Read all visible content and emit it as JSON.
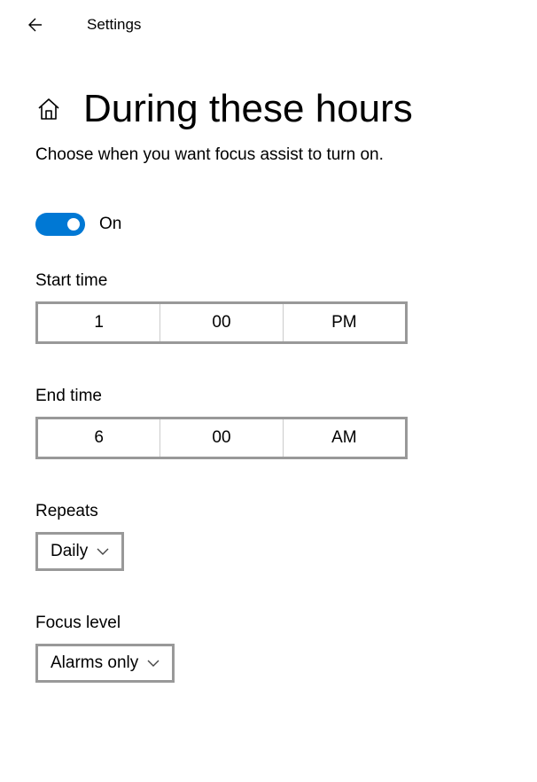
{
  "header": {
    "title": "Settings"
  },
  "page": {
    "title": "During these hours",
    "subtitle": "Choose when you want focus assist to turn on."
  },
  "toggle": {
    "label": "On",
    "state": true
  },
  "start_time": {
    "label": "Start time",
    "hour": "1",
    "minute": "00",
    "period": "PM"
  },
  "end_time": {
    "label": "End time",
    "hour": "6",
    "minute": "00",
    "period": "AM"
  },
  "repeats": {
    "label": "Repeats",
    "value": "Daily"
  },
  "focus_level": {
    "label": "Focus level",
    "value": "Alarms only"
  },
  "colors": {
    "accent": "#0078d4",
    "border": "#999999"
  }
}
